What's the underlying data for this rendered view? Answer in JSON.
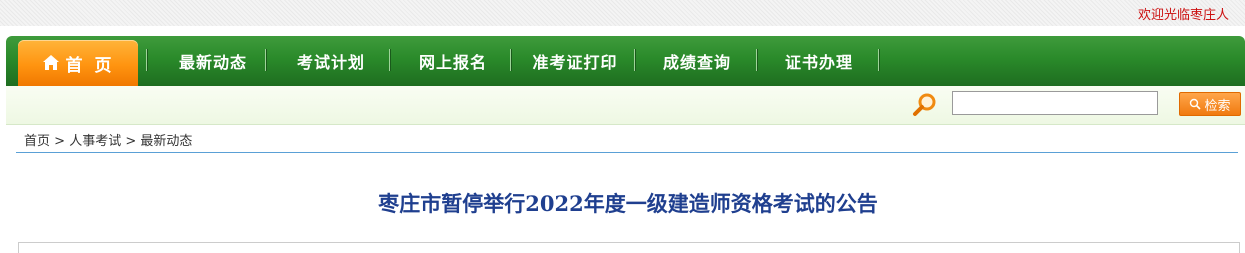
{
  "header": {
    "welcome": "欢迎光临枣庄人"
  },
  "nav": {
    "home": "首 页",
    "items": [
      "最新动态",
      "考试计划",
      "网上报名",
      "准考证打印",
      "成绩查询",
      "证书办理"
    ]
  },
  "search": {
    "value": "",
    "placeholder": "",
    "button_label": "检索"
  },
  "breadcrumb": {
    "items": [
      "首页",
      "人事考试",
      "最新动态"
    ],
    "separator": ">"
  },
  "article": {
    "title": "枣庄市暂停举行2022年度一级建造师资格考试的公告"
  },
  "colors": {
    "nav_green": "#2a8a2a",
    "home_orange": "#ff9410",
    "title_blue": "#1f3f8f",
    "welcome_red": "#cc1111"
  }
}
